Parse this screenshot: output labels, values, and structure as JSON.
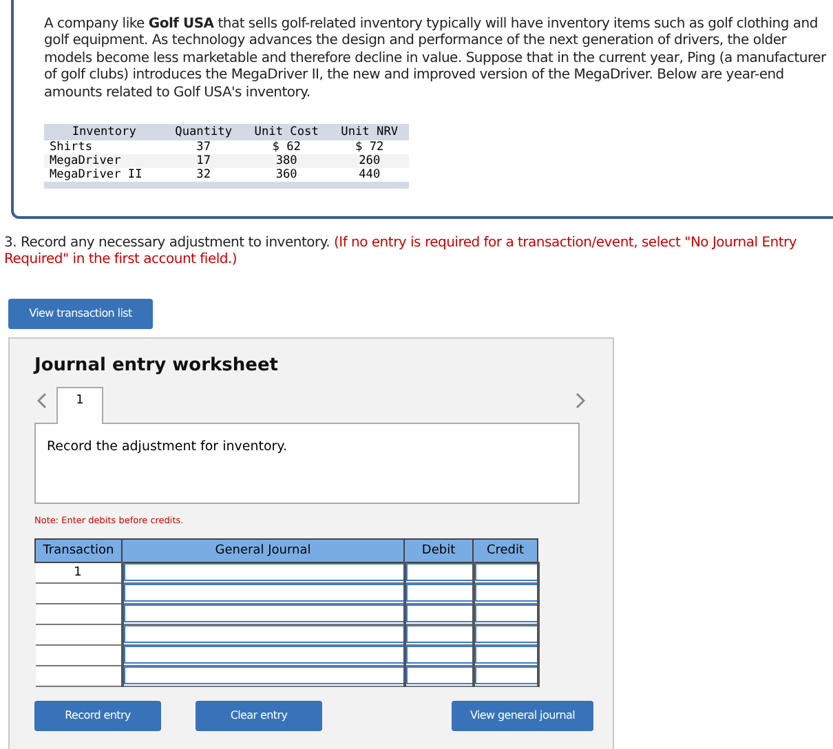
{
  "intro": {
    "text": "A company like **Golf USA** that sells golf-related inventory typically will have inventory items such as golf clothing and golf equipment. As technology advances the design and performance of the next generation of drivers, the older models become less marketable and therefore decline in value. Suppose that in the current year, Ping (a manufacturer of golf clubs) introduces the MegaDriver II, the new and improved version of the MegaDriver. Below are year-end amounts related to Golf USA's inventory.",
    "table": {
      "columns": [
        "Inventory",
        "Quantity",
        "Unit Cost",
        "Unit NRV"
      ],
      "rows": [
        [
          "Shirts",
          "37",
          "$ 62",
          "$ 72"
        ],
        [
          "MegaDriver",
          "17",
          "380",
          "260"
        ],
        [
          "MegaDriver II",
          "32",
          "360",
          "440"
        ]
      ]
    }
  },
  "question": {
    "text": "3. Record any necessary adjustment to inventory.",
    "instruction": "(If no entry is required for a transaction/event, select \"No Journal Entry Required\" in the first account field.)"
  },
  "view_transaction_button": "View transaction list",
  "worksheet": {
    "title": "Journal entry worksheet",
    "tabs": [
      {
        "label": "1",
        "selected": true
      }
    ],
    "prompt": "Record the adjustment for inventory.",
    "note": "Note: Enter debits before credits.",
    "journal": {
      "columns": [
        "Transaction",
        "General Journal",
        "Debit",
        "Credit"
      ],
      "rows": [
        {
          "kind": "entry",
          "transaction": "1"
        },
        {
          "kind": "entry"
        },
        {
          "kind": "entry"
        },
        {
          "kind": "entry"
        },
        {
          "kind": "entry"
        },
        {
          "kind": "entry"
        }
      ]
    },
    "buttons": [
      "Record entry",
      "Clear entry",
      "View general journal"
    ]
  }
}
